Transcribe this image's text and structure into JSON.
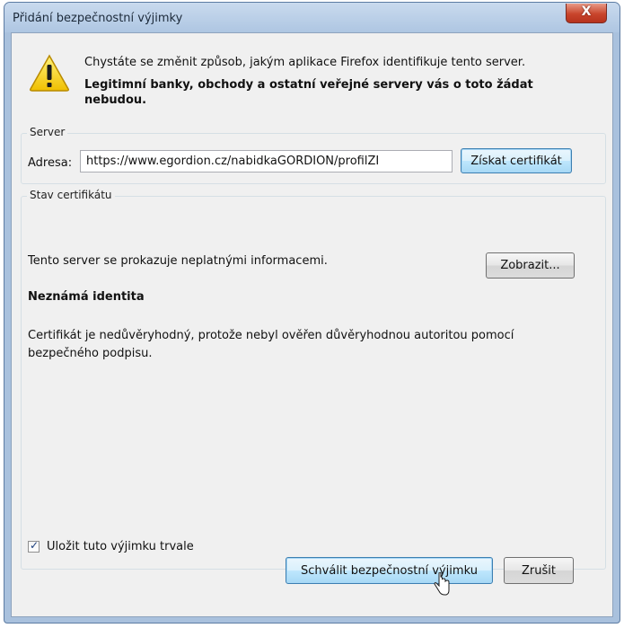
{
  "window": {
    "title": "Přidání bezpečnostní výjimky",
    "close_glyph": "X"
  },
  "message": {
    "line1": "Chystáte se změnit způsob, jakým aplikace Firefox identifikuje tento server.",
    "line2": "Legitimní banky, obchody a ostatní veřejné servery vás o toto žádat nebudou."
  },
  "server": {
    "legend": "Server",
    "address_label": "Adresa:",
    "address_value": "https://www.egordion.cz/nabidkaGORDION/profilZI",
    "get_cert_button": "Získat certifikát"
  },
  "cert_status": {
    "legend": "Stav certifikátu",
    "status_text": "Tento server se prokazuje neplatnými informacemi.",
    "view_button": "Zobrazit...",
    "identity_heading": "Neznámá identita",
    "description": "Certifikát je nedůvěryhodný, protože nebyl ověřen důvěryhodnou autoritou pomocí bezpečného podpisu."
  },
  "save_permanently": {
    "label": "Uložit tuto výjimku trvale",
    "checked": true,
    "check_glyph": "✓"
  },
  "buttons": {
    "approve": "Schválit bezpečnostní výjimku",
    "cancel": "Zrušit"
  },
  "icons": {
    "warning": "warning-triangle-icon",
    "close": "close-icon",
    "cursor": "mouse-cursor-icon"
  },
  "colors": {
    "window_frame": "#a9c1dd",
    "close_button": "#c9452c",
    "dialog_background": "#f0f0f0",
    "warning_yellow": "#f7d21e"
  }
}
